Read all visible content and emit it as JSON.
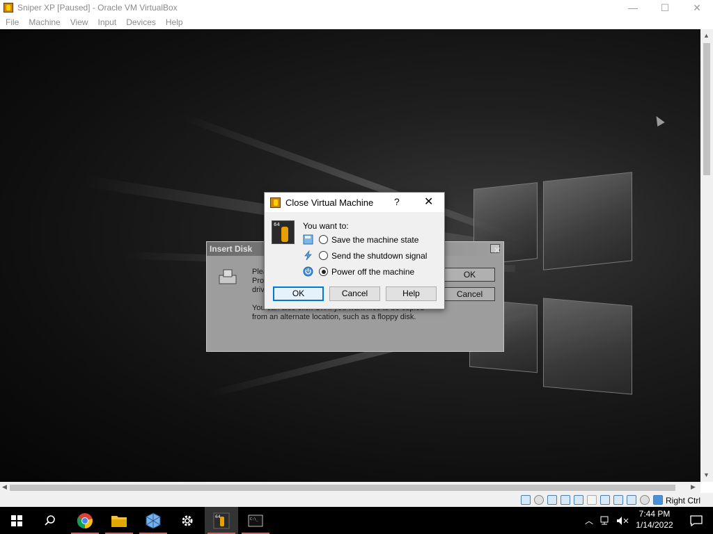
{
  "window": {
    "title": "Sniper XP [Paused] - Oracle VM VirtualBox",
    "minimize_glyph": "—",
    "maximize_glyph": "☐",
    "close_glyph": "✕"
  },
  "menubar": {
    "items": [
      "File",
      "Machine",
      "View",
      "Input",
      "Devices",
      "Help"
    ]
  },
  "insert_disk": {
    "title": "Insert Disk",
    "text_1": "Plea",
    "text_2": "Prof",
    "text_3": "driv",
    "text_4": "You can also click OK if you want files to be copied",
    "text_5": "from an alternate location, such as a floppy disk.",
    "ok_label": "OK",
    "cancel_label": "Cancel",
    "close_glyph": "✕"
  },
  "close_vm_dialog": {
    "title": "Close Virtual Machine",
    "help_glyph": "?",
    "close_glyph": "✕",
    "prompt": "You want to:",
    "options": [
      {
        "label": "Save the machine state",
        "icon": "save-state-icon",
        "checked": false
      },
      {
        "label": "Send the shutdown signal",
        "icon": "acpi-shutdown-icon",
        "checked": false
      },
      {
        "label": "Power off the machine",
        "icon": "power-off-icon",
        "checked": true
      }
    ],
    "ok_label": "OK",
    "cancel_label": "Cancel",
    "help_label": "Help"
  },
  "statusbar": {
    "host_key_label": "Right Ctrl",
    "icons": [
      "hard-disk-icon",
      "optical-drive-icon",
      "audio-icon",
      "network-icon",
      "usb-icon",
      "shared-folders-icon",
      "display-icon",
      "video-capture-icon",
      "virtualization-icon",
      "mouse-integration-icon",
      "keyboard-capture-icon"
    ]
  },
  "taskbar": {
    "items": [
      "start-button",
      "search-button",
      "chrome-app",
      "file-explorer-app",
      "virtualbox-manager-app",
      "settings-app",
      "sniper-xp-vm-app",
      "terminal-app"
    ],
    "active_item": "sniper-xp-vm-app",
    "time": "7:44 PM",
    "date": "1/14/2022"
  },
  "colors": {
    "accent": "#0078d7",
    "vm_background": "#1a1a1a",
    "dialog_bg": "#f0f0f0"
  }
}
